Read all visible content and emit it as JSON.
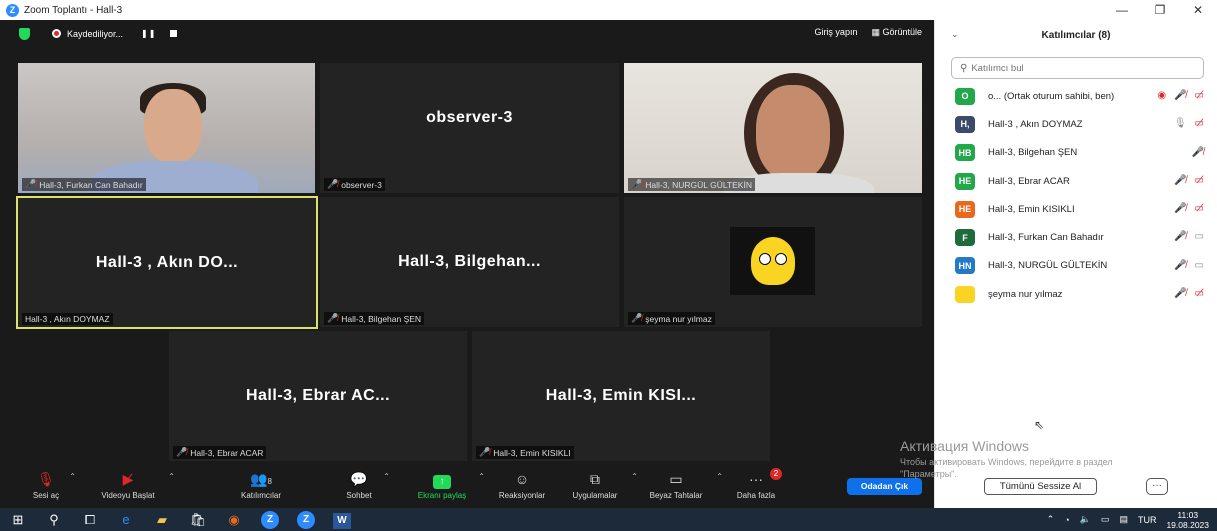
{
  "window": {
    "title": "Zoom Toplantı - Hall-3",
    "controls": [
      "—",
      "❐",
      "✕"
    ]
  },
  "topbar": {
    "recording_label": "Kaydediliyor...",
    "pause_glyph": "❚❚",
    "signin": "Giriş yapın",
    "view": "Görüntüle"
  },
  "tiles": [
    {
      "big": "",
      "tag": "Hall-3, Furkan Can Bahadır"
    },
    {
      "big": "observer-3",
      "tag": "observer-3"
    },
    {
      "big": "",
      "tag": "Hall-3, NURGÜL GÜLTEKİN"
    },
    {
      "big": "Hall-3 , Akın DO...",
      "tag": "Hall-3 , Akın DOYMAZ"
    },
    {
      "big": "Hall-3,  Bilgehan...",
      "tag": "Hall-3, Bilgehan ŞEN"
    },
    {
      "big": "",
      "tag": "şeyma nur yılmaz"
    },
    {
      "big": "Hall-3, Ebrar AC...",
      "tag": "Hall-3, Ebrar ACAR"
    },
    {
      "big": "Hall-3, Emin KISI...",
      "tag": "Hall-3, Emin KISIKLI"
    }
  ],
  "toolbar": {
    "unmute": "Sesi aç",
    "start_video": "Videoyu Başlat",
    "participants": "Katılımcılar",
    "participants_count": "8",
    "chat": "Sohbet",
    "share": "Ekranı paylaş",
    "reactions": "Reaksiyonlar",
    "apps": "Uygulamalar",
    "whiteboards": "Beyaz Tahtalar",
    "more": "Daha fazla",
    "more_badge": "2",
    "leave": "Odadan Çık"
  },
  "panel": {
    "title": "Katılımcılar (8)",
    "search_placeholder": "Katılımcı bul",
    "participants": [
      {
        "initials": "O",
        "color": "#22A74A",
        "name": "o... (Ortak oturum sahibi, ben)"
      },
      {
        "initials": "H,",
        "color": "#3B4A6B",
        "name": "Hall-3 , Akın DOYMAZ"
      },
      {
        "initials": "HB",
        "color": "#22A74A",
        "name": "Hall-3, Bilgehan ŞEN"
      },
      {
        "initials": "HE",
        "color": "#22A74A",
        "name": "Hall-3, Ebrar ACAR"
      },
      {
        "initials": "HE",
        "color": "#E8681E",
        "name": "Hall-3, Emin KISIKLI"
      },
      {
        "initials": "F",
        "color": "#1E6B3C",
        "name": "Hall-3, Furkan Can Bahadır"
      },
      {
        "initials": "HN",
        "color": "#2478C8",
        "name": "Hall-3, NURGÜL GÜLTEKİN"
      },
      {
        "initials": "",
        "color": "#F9D423",
        "name": "şeyma nur yılmaz"
      }
    ],
    "mute_all": "Tümünü Sessize Al",
    "more": "···"
  },
  "windows_watermark": {
    "line1": "Активация Windows",
    "line2": "Чтобы активировать Windows, перейдите в раздел \"Параметры\"."
  },
  "taskbar": {
    "lang": "TUR",
    "time": "11:03",
    "date": "19.08.2023"
  }
}
